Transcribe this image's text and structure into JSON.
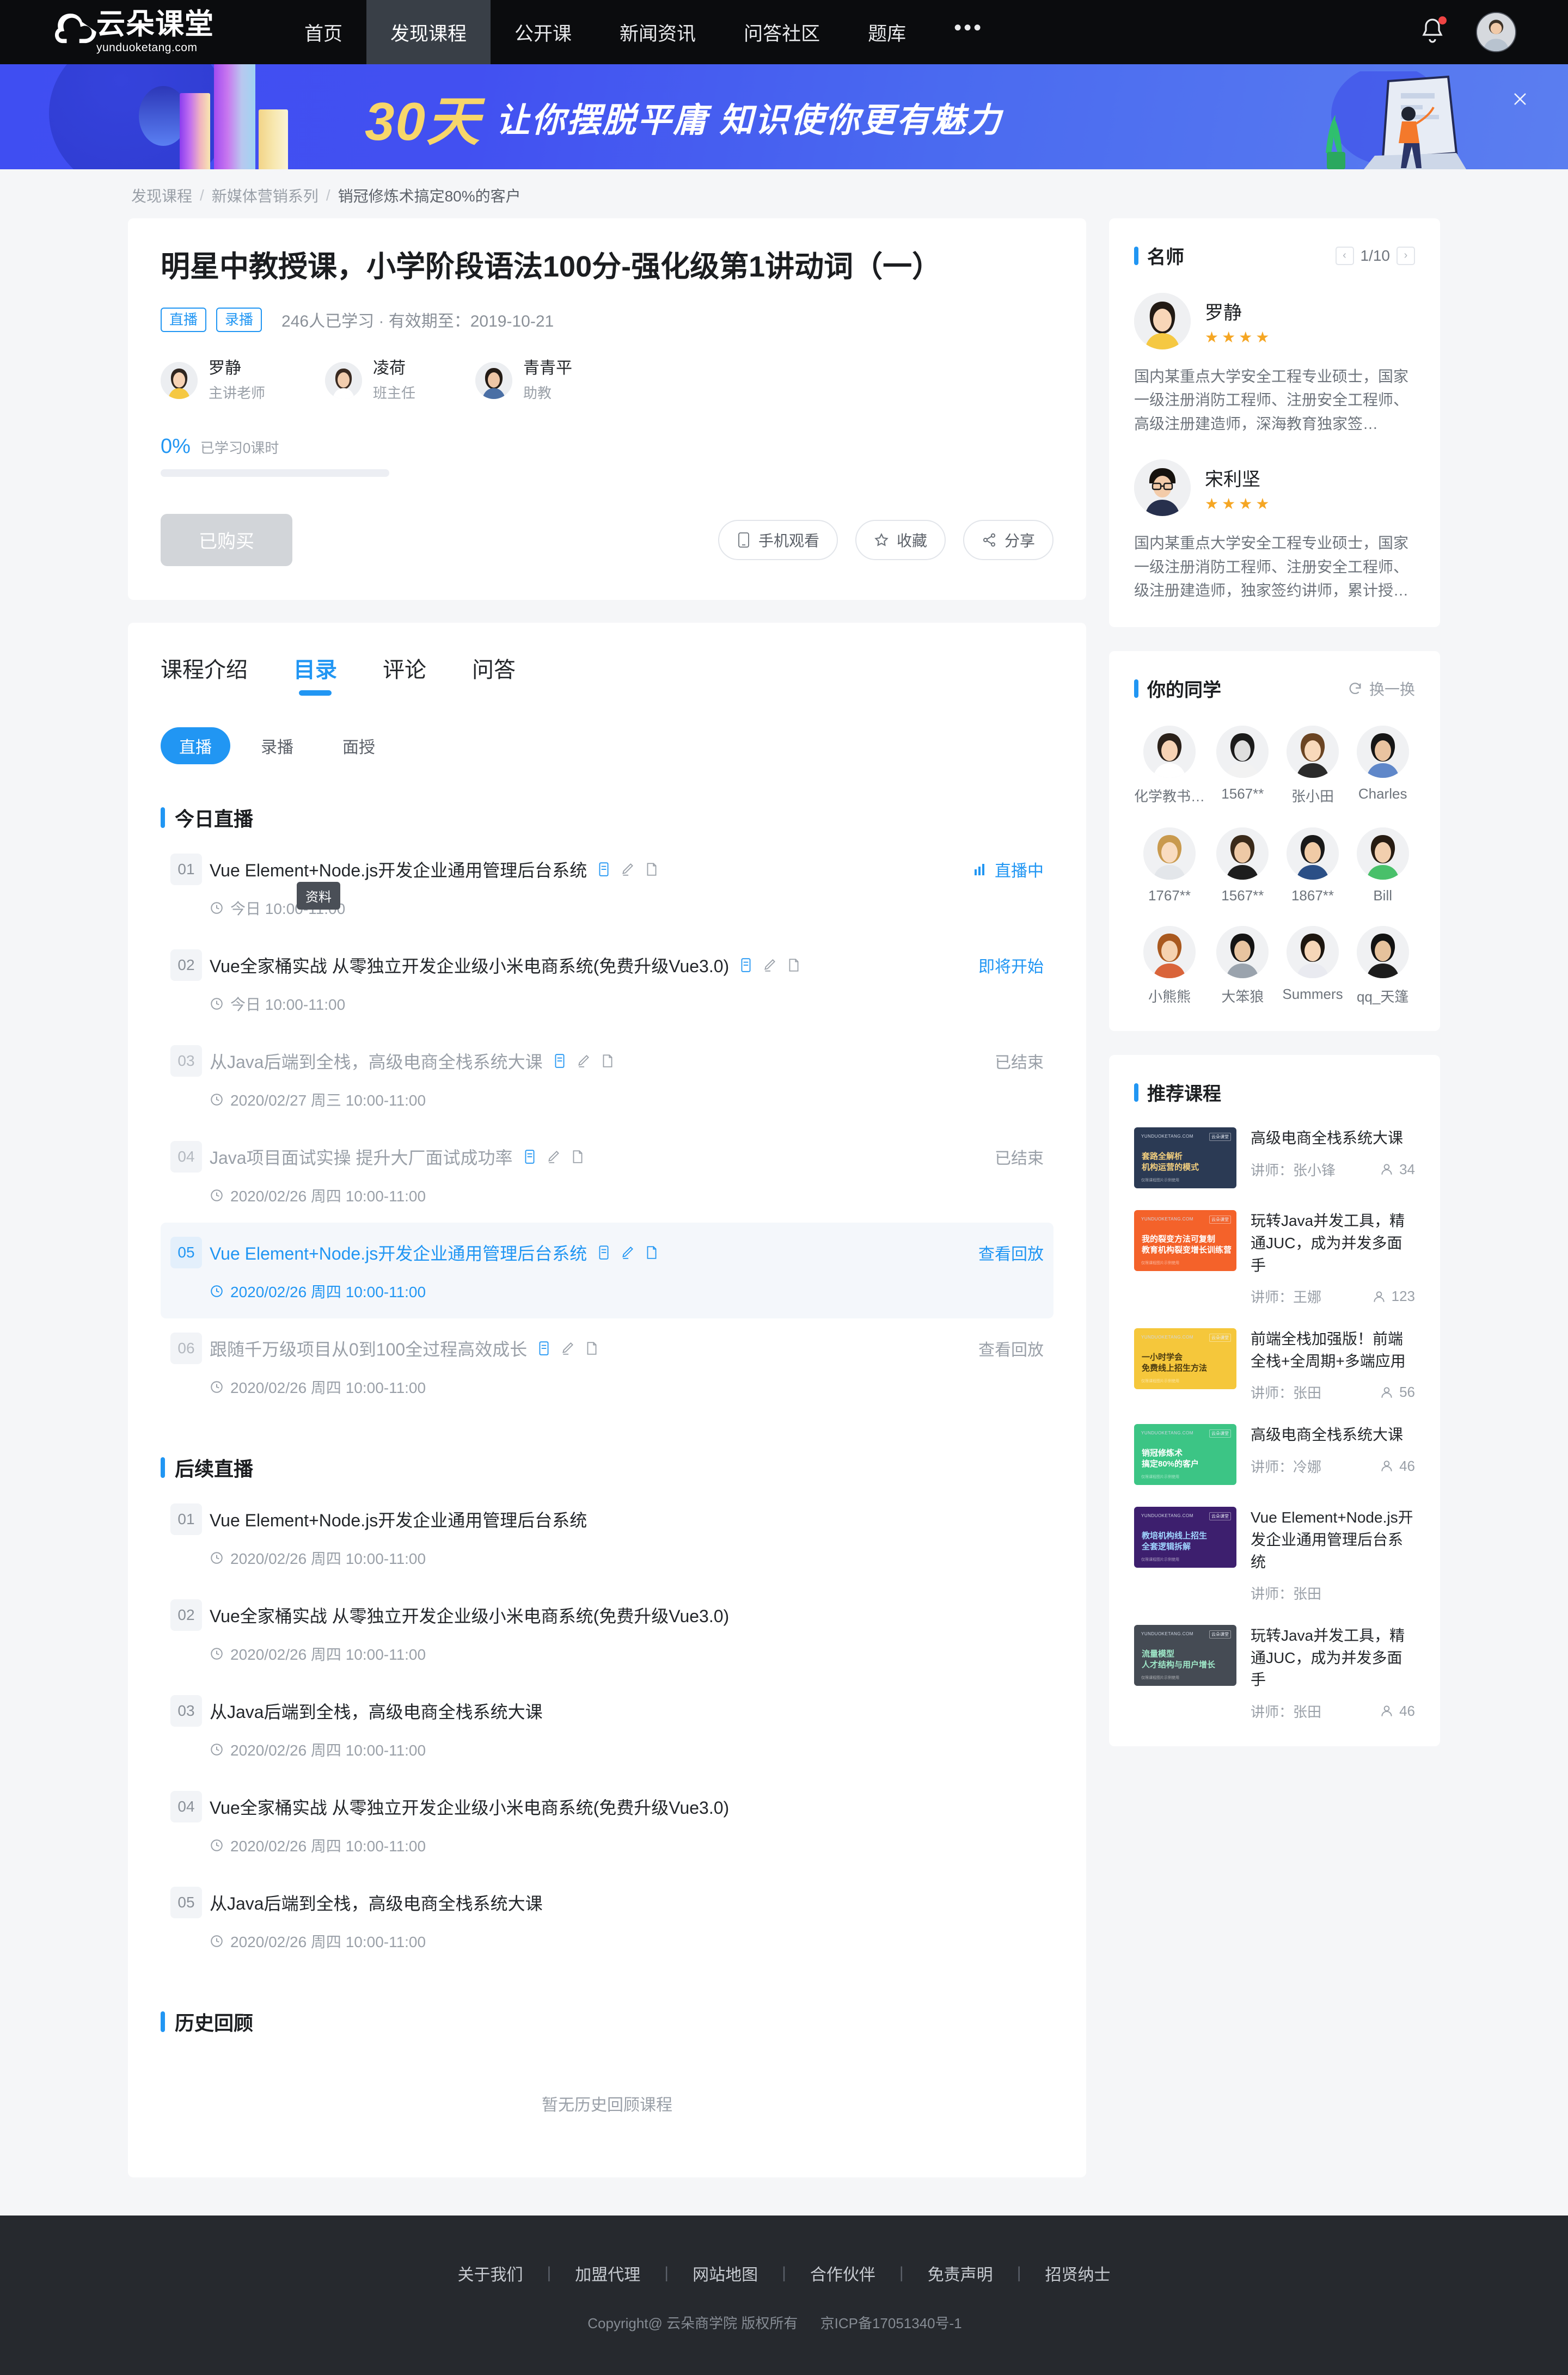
{
  "nav": {
    "logo_cn": "云朵课堂",
    "logo_en": "yunduoketang.com",
    "items": [
      {
        "label": "首页",
        "active": false
      },
      {
        "label": "发现课程",
        "active": true
      },
      {
        "label": "公开课",
        "active": false
      },
      {
        "label": "新闻资讯",
        "active": false
      },
      {
        "label": "问答社区",
        "active": false
      },
      {
        "label": "题库",
        "active": false
      }
    ],
    "more": "•••"
  },
  "banner": {
    "days": "30天",
    "slogan": "让你摆脱平庸  知识使你更有魅力",
    "close_icon": "close-icon"
  },
  "breadcrumb": {
    "items": [
      "发现课程",
      "新媒体营销系列",
      "销冠修炼术搞定80%的客户"
    ],
    "separator": "/"
  },
  "course": {
    "title": "明星中教授课，小学阶段语法100分-强化级第1讲动词（一）",
    "tags": [
      "直播",
      "录播"
    ],
    "meta": "246人已学习 · 有效期至：2019-10-21",
    "teachers": [
      {
        "name": "罗静",
        "role": "主讲老师"
      },
      {
        "name": "凌荷",
        "role": "班主任"
      },
      {
        "name": "青青平",
        "role": "助教"
      }
    ],
    "progress": {
      "percent": "0%",
      "value": 0,
      "label": "已学习0课时"
    },
    "buy_button": "已购买",
    "actions": [
      {
        "label": "手机观看",
        "icon": "phone-icon"
      },
      {
        "label": "收藏",
        "icon": "star-icon"
      },
      {
        "label": "分享",
        "icon": "share-icon"
      }
    ]
  },
  "catalog": {
    "tabs": [
      {
        "label": "课程介绍",
        "active": false
      },
      {
        "label": "目录",
        "active": true
      },
      {
        "label": "评论",
        "active": false
      },
      {
        "label": "问答",
        "active": false
      }
    ],
    "subtabs": [
      {
        "label": "直播",
        "active": true
      },
      {
        "label": "录播",
        "active": false
      },
      {
        "label": "面授",
        "active": false
      }
    ],
    "tooltip": "资料",
    "sections": [
      {
        "title": "今日直播",
        "lessons": [
          {
            "num": "01",
            "title": "Vue Element+Node.js开发企业通用管理后台系统",
            "time": "今日 10:00-11:00",
            "status": "直播中",
            "status_type": "live",
            "icons": true,
            "state": "normal"
          },
          {
            "num": "02",
            "title": "Vue全家桶实战 从零独立开发企业级小米电商系统(免费升级Vue3.0)",
            "time": "今日 10:00-11:00",
            "status": "即将开始",
            "status_type": "soon",
            "icons": true,
            "state": "normal"
          },
          {
            "num": "03",
            "title": "从Java后端到全栈，高级电商全栈系统大课",
            "time": "2020/02/27 周三 10:00-11:00",
            "status": "已结束",
            "status_type": "over",
            "icons": true,
            "state": "dim"
          },
          {
            "num": "04",
            "title": "Java项目面试实操 提升大厂面试成功率",
            "time": "2020/02/26 周四 10:00-11:00",
            "status": "已结束",
            "status_type": "over",
            "icons": true,
            "state": "dim"
          },
          {
            "num": "05",
            "title": "Vue Element+Node.js开发企业通用管理后台系统",
            "time": "2020/02/26 周四 10:00-11:00",
            "status": "查看回放",
            "status_type": "replay-on",
            "icons": true,
            "state": "hl"
          },
          {
            "num": "06",
            "title": "跟随千万级项目从0到100全过程高效成长",
            "time": "2020/02/26 周四 10:00-11:00",
            "status": "查看回放",
            "status_type": "over",
            "icons": true,
            "state": "dim"
          }
        ]
      },
      {
        "title": "后续直播",
        "lessons": [
          {
            "num": "01",
            "title": "Vue Element+Node.js开发企业通用管理后台系统",
            "time": "2020/02/26 周四 10:00-11:00",
            "status": "",
            "status_type": "none",
            "icons": false,
            "state": "normal"
          },
          {
            "num": "02",
            "title": "Vue全家桶实战 从零独立开发企业级小米电商系统(免费升级Vue3.0)",
            "time": "2020/02/26 周四 10:00-11:00",
            "status": "",
            "status_type": "none",
            "icons": false,
            "state": "normal"
          },
          {
            "num": "03",
            "title": "从Java后端到全栈，高级电商全栈系统大课",
            "time": "2020/02/26 周四 10:00-11:00",
            "status": "",
            "status_type": "none",
            "icons": false,
            "state": "normal"
          },
          {
            "num": "04",
            "title": "Vue全家桶实战 从零独立开发企业级小米电商系统(免费升级Vue3.0)",
            "time": "2020/02/26 周四 10:00-11:00",
            "status": "",
            "status_type": "none",
            "icons": false,
            "state": "normal"
          },
          {
            "num": "05",
            "title": "从Java后端到全栈，高级电商全栈系统大课",
            "time": "2020/02/26 周四 10:00-11:00",
            "status": "",
            "status_type": "none",
            "icons": false,
            "state": "normal"
          }
        ]
      },
      {
        "title": "历史回顾",
        "lessons": [],
        "empty_text": "暂无历史回顾课程"
      }
    ]
  },
  "sidebar": {
    "famous_teachers": {
      "title": "名师",
      "pager": "1/10",
      "prev_icon": "chevron-left-icon",
      "next_icon": "chevron-right-icon",
      "items": [
        {
          "name": "罗静",
          "stars": 4,
          "desc": "国内某重点大学安全工程专业硕士，国家一级注册消防工程师、注册安全工程师、高级注册建造师，深海教育独家签…"
        },
        {
          "name": "宋利坚",
          "stars": 4,
          "desc": "国内某重点大学安全工程专业硕士，国家一级注册消防工程师、注册安全工程师、级注册建造师，独家签约讲师，累计授…"
        }
      ]
    },
    "classmates": {
      "title": "你的同学",
      "refresh_label": "换一换",
      "refresh_icon": "refresh-icon",
      "items": [
        {
          "name": "化学教书…"
        },
        {
          "name": "1567**"
        },
        {
          "name": "张小田"
        },
        {
          "name": "Charles"
        },
        {
          "name": "1767**"
        },
        {
          "name": "1567**"
        },
        {
          "name": "1867**"
        },
        {
          "name": "Bill"
        },
        {
          "name": "小熊熊"
        },
        {
          "name": "大笨狼"
        },
        {
          "name": "Summers"
        },
        {
          "name": "qq_天篷"
        }
      ]
    },
    "recommended": {
      "title": "推荐课程",
      "teacher_prefix": "讲师：",
      "items": [
        {
          "title": "高级电商全栈系统大课",
          "teacher": "张小锋",
          "count": "34",
          "thumb_color": "#2b3a54",
          "thumb_line1": "套路全解析",
          "thumb_line2": "机构运营的模式",
          "thumb_accent": "#f3cf7e"
        },
        {
          "title": "玩转Java并发工具，精通JUC，成为并发多面手",
          "teacher": "王娜",
          "count": "123",
          "thumb_color": "#f4622a",
          "thumb_line1": "我的裂变方法可复制",
          "thumb_line2": "教育机构裂变增长训练营",
          "thumb_accent": "#ffffff"
        },
        {
          "title": "前端全栈加强版！前端全栈+全周期+多端应用",
          "teacher": "张田",
          "count": "56",
          "thumb_color": "#f5c73b",
          "thumb_line1": "一小时学会",
          "thumb_line2": "免费线上招生方法",
          "thumb_accent": "#4a3a10"
        },
        {
          "title": "高级电商全栈系统大课",
          "teacher": "冷娜",
          "count": "46",
          "thumb_color": "#3cc585",
          "thumb_line1": "销冠修炼术",
          "thumb_line2": "搞定80%的客户",
          "thumb_accent": "#ffffff"
        },
        {
          "title": "Vue Element+Node.js开发企业通用管理后台系统",
          "teacher": "张田",
          "count": "",
          "thumb_color": "#3d1f6e",
          "thumb_line1": "教培机构线上招生",
          "thumb_line2": "全套逻辑拆解",
          "thumb_accent": "#9fd4ff"
        },
        {
          "title": "玩转Java并发工具，精通JUC，成为并发多面手",
          "teacher": "张田",
          "count": "46",
          "thumb_color": "#454b54",
          "thumb_line1": "流量模型",
          "thumb_line2": "人才结构与用户增长",
          "thumb_accent": "#9fe8c8"
        }
      ]
    }
  },
  "footer": {
    "links": [
      "关于我们",
      "加盟代理",
      "网站地图",
      "合作伙伴",
      "免责声明",
      "招贤纳士"
    ],
    "copyright": "Copyright@ 云朵商学院   版权所有",
    "icp": "京ICP备17051340号-1"
  }
}
